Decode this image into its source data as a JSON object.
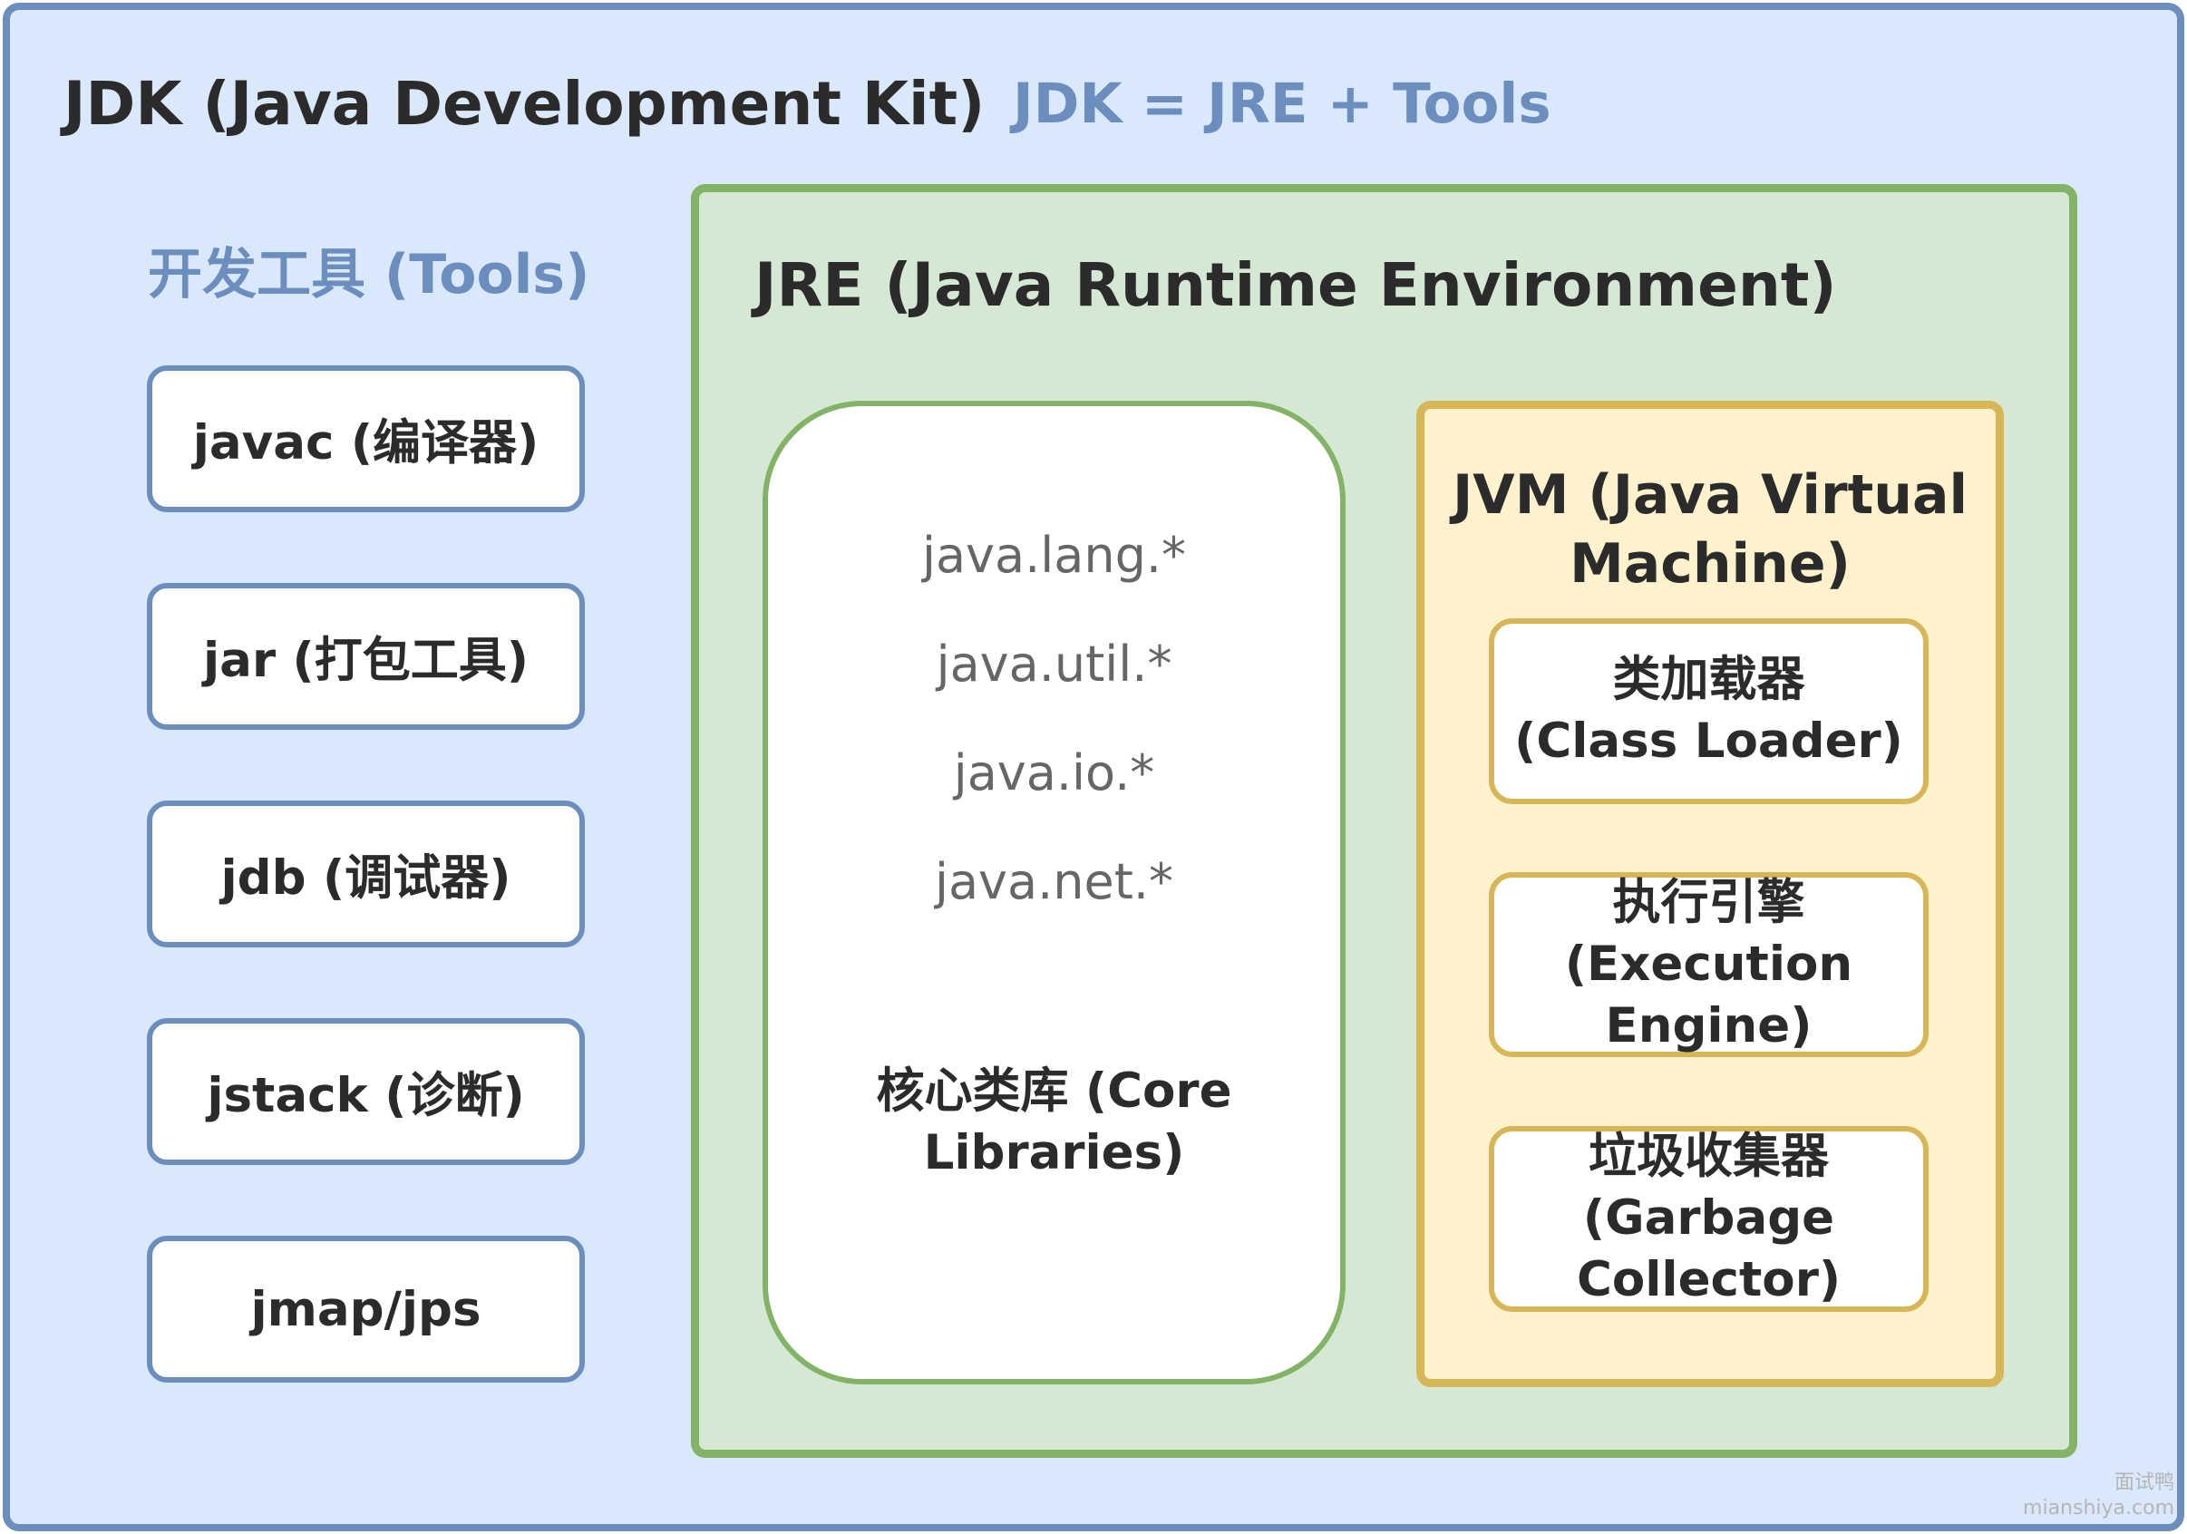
{
  "jdk": {
    "title": "JDK (Java Development Kit)",
    "formula": "JDK = JRE + Tools"
  },
  "tools": {
    "header": "开发工具 (Tools)",
    "items": [
      {
        "label": "javac (编译器)"
      },
      {
        "label": "jar (打包工具)"
      },
      {
        "label": "jdb (调试器)"
      },
      {
        "label": "jstack (诊断)"
      },
      {
        "label": "jmap/jps"
      }
    ]
  },
  "jre": {
    "title": "JRE (Java Runtime Environment)",
    "core_libraries": {
      "packages": [
        "java.lang.*",
        "java.util.*",
        "java.io.*",
        "java.net.*"
      ],
      "label_line1": "核心类库 (Core",
      "label_line2": "Libraries)"
    },
    "jvm": {
      "title_line1": "JVM (Java Virtual",
      "title_line2": "Machine)",
      "components": [
        {
          "line1": "类加载器",
          "line2": "(Class Loader)",
          "line3": ""
        },
        {
          "line1": "执行引擎",
          "line2": "(Execution",
          "line3": "Engine)"
        },
        {
          "line1": "垃圾收集器",
          "line2": "(Garbage",
          "line3": "Collector)"
        }
      ]
    }
  },
  "watermark": {
    "line1": "面试鸭",
    "line2": "mianshiya.com"
  },
  "colors": {
    "jdk_fill": "#dae8fc",
    "jdk_border": "#6c8ebf",
    "jre_fill": "#d5e8d4",
    "jre_border": "#82b366",
    "jvm_fill": "#fff2cc",
    "jvm_border": "#d6b656"
  }
}
